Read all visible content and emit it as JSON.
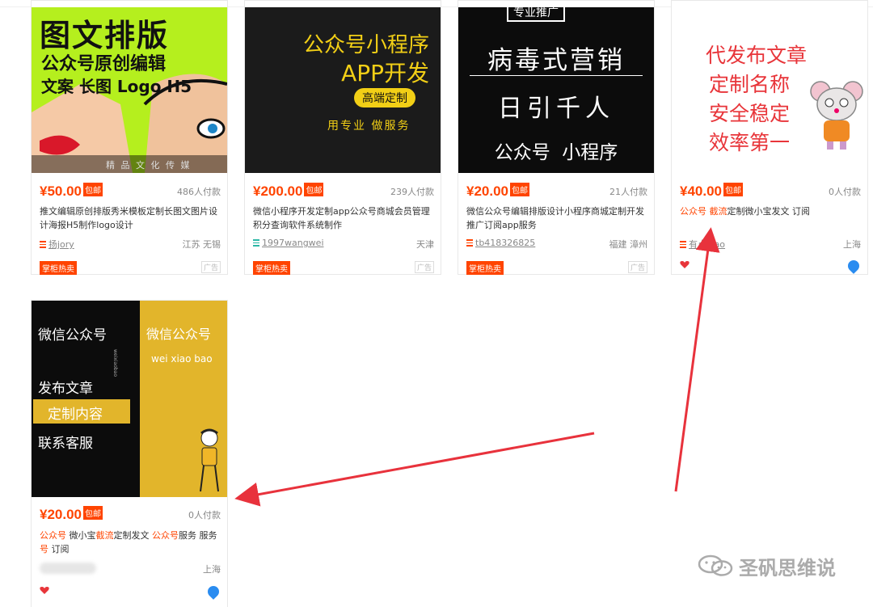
{
  "cards": [
    {
      "thumb": {
        "lines": [
          "图文排版",
          "公众号原创编辑",
          "文案 长图 Logo H5"
        ],
        "caption": "精 品 文 化 传 媒"
      },
      "price": "¥50.00",
      "baoyou": "包邮",
      "sales": "486人付款",
      "title_parts": [
        "推文编辑原创排版秀米模板定制长图文图片设计海报H5制作logo设计"
      ],
      "shop": "扬jory",
      "location": "江苏 无锡",
      "hot": "掌柜热卖",
      "ad": "广告"
    },
    {
      "thumb": {
        "lines": [
          "公众号小程序",
          "APP开发"
        ],
        "pill": "高端定制",
        "sub": "用专业 做服务"
      },
      "price": "¥200.00",
      "baoyou": "包邮",
      "sales": "239人付款",
      "title_parts": [
        "微信小程序开发定制app公众号商城会员管理积分查询软件系统制作"
      ],
      "shop": "1997wangwei",
      "location": "天津",
      "hot": "掌柜热卖",
      "ad": "广告"
    },
    {
      "thumb": {
        "top": "专业推广",
        "lines": [
          "病毒式营销",
          "日引千人",
          "公众号  小程序"
        ]
      },
      "price": "¥20.00",
      "baoyou": "包邮",
      "sales": "21人付款",
      "title_parts": [
        "微信公众号编辑排版设计小程序商城定制开发推广订阅app服务"
      ],
      "shop": "tb418326825",
      "location": "福建 漳州",
      "hot": "掌柜热卖",
      "ad": "广告"
    },
    {
      "thumb": {
        "lines": [
          "代发布文章",
          "定制名称",
          "安全稳定",
          "效率第一"
        ]
      },
      "price": "¥40.00",
      "baoyou": "包邮",
      "sales": "0人付款",
      "title_parts": [
        "公众号",
        " ",
        "截流",
        "定制微小宝发文 订阅"
      ],
      "shop": "有点xiao",
      "location": "上海"
    },
    {
      "thumb": {
        "left": [
          "微信公众号",
          "发布文章",
          "定制内容",
          "联系客服"
        ],
        "right": [
          "微信公众号",
          "wei xiao bao"
        ],
        "vertical": "weixiaobao"
      },
      "price": "¥20.00",
      "baoyou": "包邮",
      "sales": "0人付款",
      "title_parts": [
        "公众号",
        " 微小宝",
        "截流",
        "定制发文 ",
        "公众号",
        "服务 服务",
        "号",
        " 订阅"
      ],
      "location": "上海"
    }
  ],
  "watermark": "圣矾思维说",
  "colors": {
    "accent": "#ff4400",
    "arrow": "#e8323c"
  },
  "icons": [
    "close-icon",
    "shop-icon",
    "heart-icon",
    "water-drop-icon",
    "wechat-icon"
  ]
}
